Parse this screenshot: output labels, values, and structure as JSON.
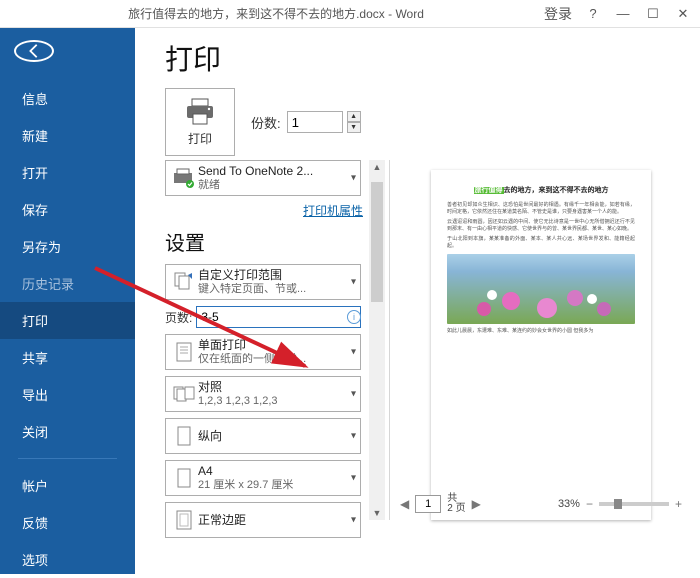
{
  "titlebar": {
    "doc_title": "旅行值得去的地方，来到这不得不去的地方.docx  -  Word",
    "login": "登录"
  },
  "sidebar": {
    "items": [
      {
        "label": "信息"
      },
      {
        "label": "新建"
      },
      {
        "label": "打开"
      },
      {
        "label": "保存"
      },
      {
        "label": "另存为"
      },
      {
        "label": "历史记录"
      },
      {
        "label": "打印"
      },
      {
        "label": "共享"
      },
      {
        "label": "导出"
      },
      {
        "label": "关闭"
      },
      {
        "label": "帐户"
      },
      {
        "label": "反馈"
      },
      {
        "label": "选项"
      }
    ]
  },
  "print": {
    "title": "打印",
    "button_label": "打印",
    "copies_label": "份数:",
    "copies_value": "1",
    "printer_name": "Send To OneNote 2...",
    "printer_status": "就绪",
    "printer_props_link": "打印机属性",
    "settings_title": "设置",
    "range_title": "自定义打印范围",
    "range_sub": "键入特定页面、节或...",
    "pages_label": "页数:",
    "pages_value": "3-5",
    "sides_title": "单面打印",
    "sides_sub": "仅在纸面的一侧上进...",
    "collate_title": "对照",
    "collate_sub": "1,2,3    1,2,3    1,2,3",
    "orient_title": "纵向",
    "paper_title": "A4",
    "paper_sub": "21 厘米 x 29.7 厘米",
    "margin_title": "正常边距"
  },
  "preview": {
    "page_title_hl": "旅行值得",
    "page_title_rest": "去的地方，来到这不得不去的地方",
    "page_num": "1",
    "total_label1": "共",
    "total_label2": "2 页",
    "zoom_pct": "33%"
  }
}
